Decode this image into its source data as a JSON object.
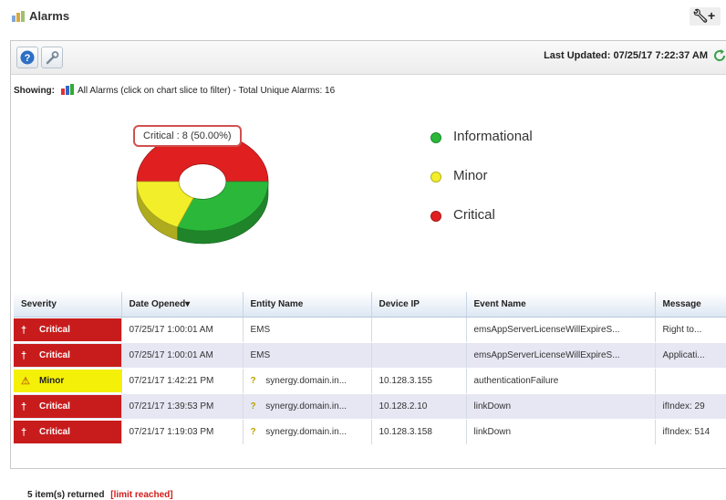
{
  "window": {
    "title": "Alarms",
    "title_icon": "alarm-bell-icon",
    "tools": {
      "settings_icon": "wrench-icon",
      "add_icon": "plus-icon"
    }
  },
  "toolbar": {
    "help_icon": "help-icon",
    "settings_icon": "wrench-icon",
    "last_updated": "Last Updated: 07/25/17 7:22:37 AM",
    "refresh_icon": "refresh-icon"
  },
  "showing": {
    "prefix": "Showing:",
    "filter_icon": "chart-filter-icon",
    "text": "All Alarms (click on chart slice to filter) - Total Unique Alarms: 16"
  },
  "chart_data": {
    "type": "pie",
    "categories": [
      "Critical",
      "Minor",
      "Informational"
    ],
    "values": [
      8,
      3,
      5
    ],
    "colors": [
      "#e02020",
      "#f2ee2a",
      "#2bb83a"
    ],
    "tooltip": "Critical : 8 (50.00%)",
    "legend": [
      "Informational",
      "Minor",
      "Critical"
    ],
    "legend_colors": [
      "#2bb83a",
      "#f2ee2a",
      "#e02020"
    ],
    "legend_placement": "right"
  },
  "table": {
    "columns": [
      "Severity",
      "Date Opened▾",
      "Entity Name",
      "Device IP",
      "Event Name",
      "Message"
    ],
    "rows": [
      {
        "severity": "Critical",
        "severity_icon": "critical-alert-icon",
        "date": "07/25/17 1:00:01 AM",
        "entity": "EMS",
        "entity_icon": "",
        "ip": "",
        "event": "emsAppServerLicenseWillExpireS...",
        "message": "Right to..."
      },
      {
        "severity": "Critical",
        "severity_icon": "critical-alert-icon",
        "date": "07/25/17 1:00:01 AM",
        "entity": "EMS",
        "entity_icon": "",
        "ip": "",
        "event": "emsAppServerLicenseWillExpireS...",
        "message": "Applicati..."
      },
      {
        "severity": "Minor",
        "severity_icon": "warning-triangle-icon",
        "date": "07/21/17 1:42:21 PM",
        "entity": "synergy.domain.in...",
        "entity_icon": "unknown-device-icon",
        "ip": "10.128.3.155",
        "event": "authenticationFailure",
        "message": ""
      },
      {
        "severity": "Critical",
        "severity_icon": "critical-alert-icon",
        "date": "07/21/17 1:39:53 PM",
        "entity": "synergy.domain.in...",
        "entity_icon": "unknown-device-icon",
        "ip": "10.128.2.10",
        "event": "linkDown",
        "message": "ifIndex: 29"
      },
      {
        "severity": "Critical",
        "severity_icon": "critical-alert-icon",
        "date": "07/21/17 1:19:03 PM",
        "entity": "synergy.domain.in...",
        "entity_icon": "unknown-device-icon",
        "ip": "10.128.3.158",
        "event": "linkDown",
        "message": "ifIndex: 514"
      }
    ]
  },
  "footer": {
    "count": "5 item(s) returned",
    "limit": "[limit reached]"
  }
}
